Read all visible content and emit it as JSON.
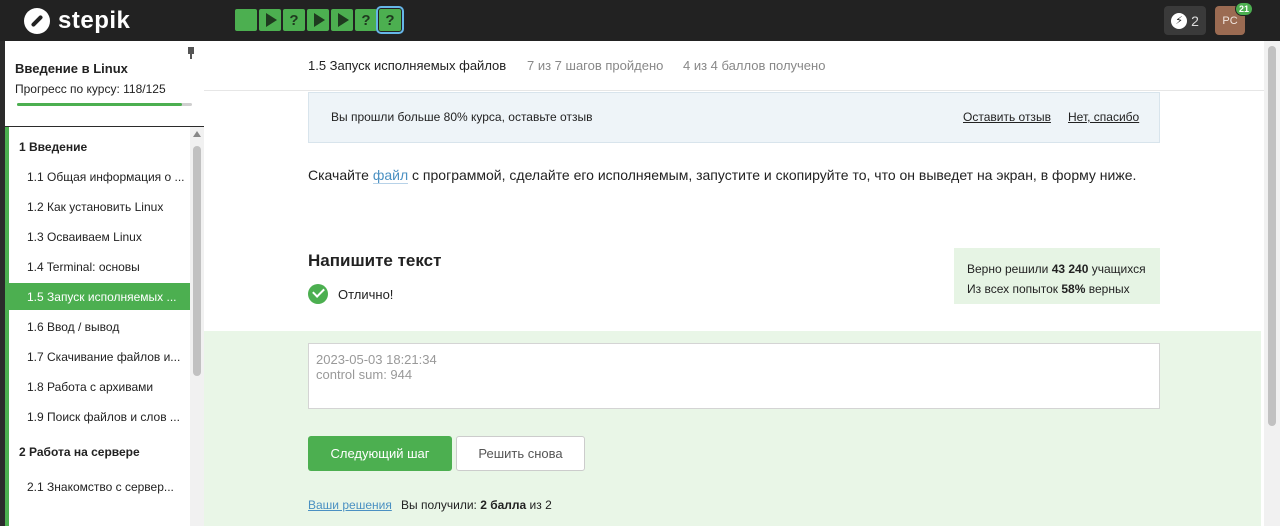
{
  "app": {
    "logo_text": "stepik"
  },
  "steps": [
    {
      "type": "text"
    },
    {
      "type": "video"
    },
    {
      "type": "quiz"
    },
    {
      "type": "video"
    },
    {
      "type": "video"
    },
    {
      "type": "quiz"
    },
    {
      "type": "quiz",
      "current": true
    }
  ],
  "steps_quiz_glyph": "?",
  "header": {
    "energy": "2",
    "avatar_initials": "PC",
    "avatar_badge": "21"
  },
  "sidebar": {
    "course_title": "Введение в Linux",
    "progress_label": "Прогресс по курсу:",
    "progress_value": "118/125",
    "progress_fraction": 0.944,
    "items": [
      {
        "label": "1  Введение",
        "section": true
      },
      {
        "label": "1.1  Общая информация о ..."
      },
      {
        "label": "1.2  Как установить Linux"
      },
      {
        "label": "1.3  Осваиваем Linux"
      },
      {
        "label": "1.4  Terminal: основы"
      },
      {
        "label": "1.5  Запуск исполняемых ...",
        "active": true
      },
      {
        "label": "1.6  Ввод / вывод"
      },
      {
        "label": "1.7  Скачивание файлов и..."
      },
      {
        "label": "1.8  Работа с архивами"
      },
      {
        "label": "1.9  Поиск файлов и слов ..."
      },
      {
        "label": "2  Работа на сервере",
        "section": true
      },
      {
        "label": "2.1  Знакомство с сервер..."
      }
    ]
  },
  "lesson": {
    "title": "1.5 Запуск исполняемых файлов",
    "steps_done": "7 из 7 шагов пройдено",
    "points": "4 из 4 баллов  получено"
  },
  "feedback": {
    "text": "Вы прошли больше 80% курса, оставьте отзыв",
    "leave": "Оставить отзыв",
    "no": "Нет, спасибо"
  },
  "instruction": {
    "before": "Скачайте ",
    "link": "файл",
    "after": " с программой, сделайте его исполняемым, запустите и скопируйте то, что он выведет на экран, в форму ниже."
  },
  "task": {
    "title": "Напишите текст",
    "result": "Отлично!"
  },
  "stats": {
    "line1_prefix": "Верно решили ",
    "line1_value": "43 240",
    "line1_suffix": " учащихся",
    "line2_prefix": "Из всех попыток ",
    "line2_value": "58%",
    "line2_suffix": " верных"
  },
  "answer": {
    "text": "2023-05-03 18:21:34\ncontrol sum: 944"
  },
  "buttons": {
    "next": "Следующий шаг",
    "again": "Решить снова"
  },
  "footer": {
    "solutions": "Ваши решения",
    "got_prefix": "Вы получили: ",
    "got_value": "2 балла",
    "got_suffix": " из 2"
  },
  "colors": {
    "accent": "#4caf50",
    "link": "#4a90c2",
    "topbar": "#222222"
  }
}
